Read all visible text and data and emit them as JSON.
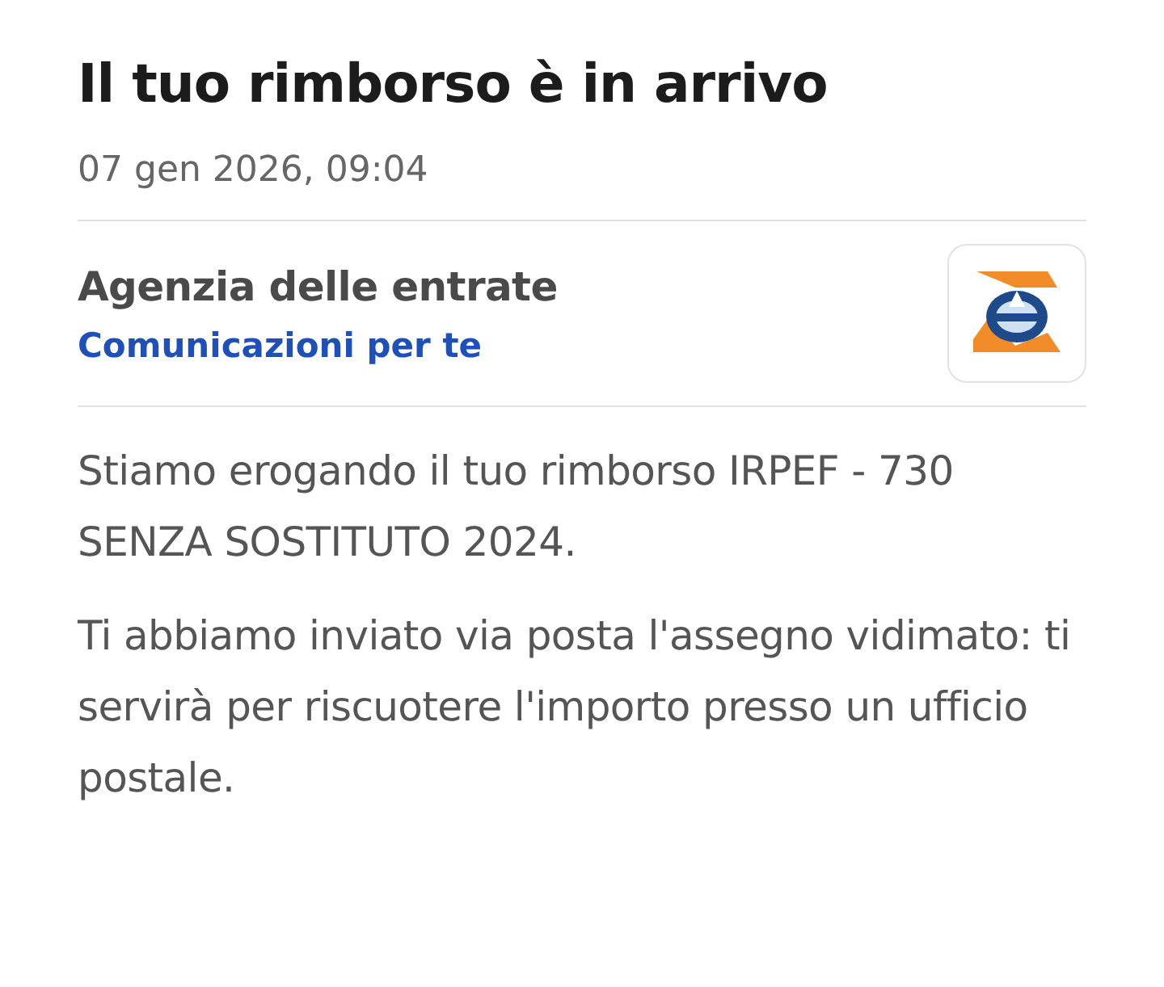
{
  "title": "Il tuo rimborso è in arrivo",
  "date": "07 gen 2026, 09:04",
  "sender": {
    "name": "Agenzia delle entrate",
    "category": "Comunicazioni per te"
  },
  "paragraphs": [
    "Stiamo erogando il tuo rimborso IRPEF - 730 SENZA SOSTITUTO 2024.",
    "Ti abbiamo inviato via posta l'assegno vidimato: ti servirà per riscuotere l'importo presso un ufficio postale."
  ]
}
